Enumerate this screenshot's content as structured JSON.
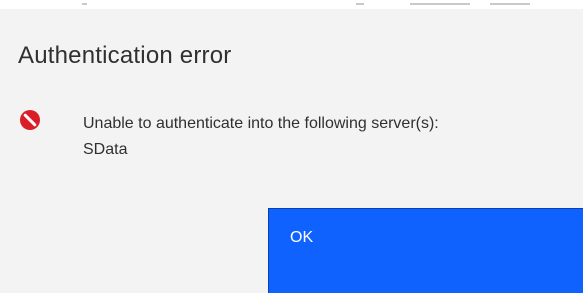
{
  "dialog": {
    "title": "Authentication error",
    "icon": "error-icon",
    "message_line1": "Unable to authenticate into the following server(s):",
    "message_line2": "SData",
    "ok_label": "OK"
  },
  "colors": {
    "background": "#f3f3f3",
    "primary_button": "#0f62fe",
    "error_icon": "#da1e28",
    "text": "#303030"
  }
}
